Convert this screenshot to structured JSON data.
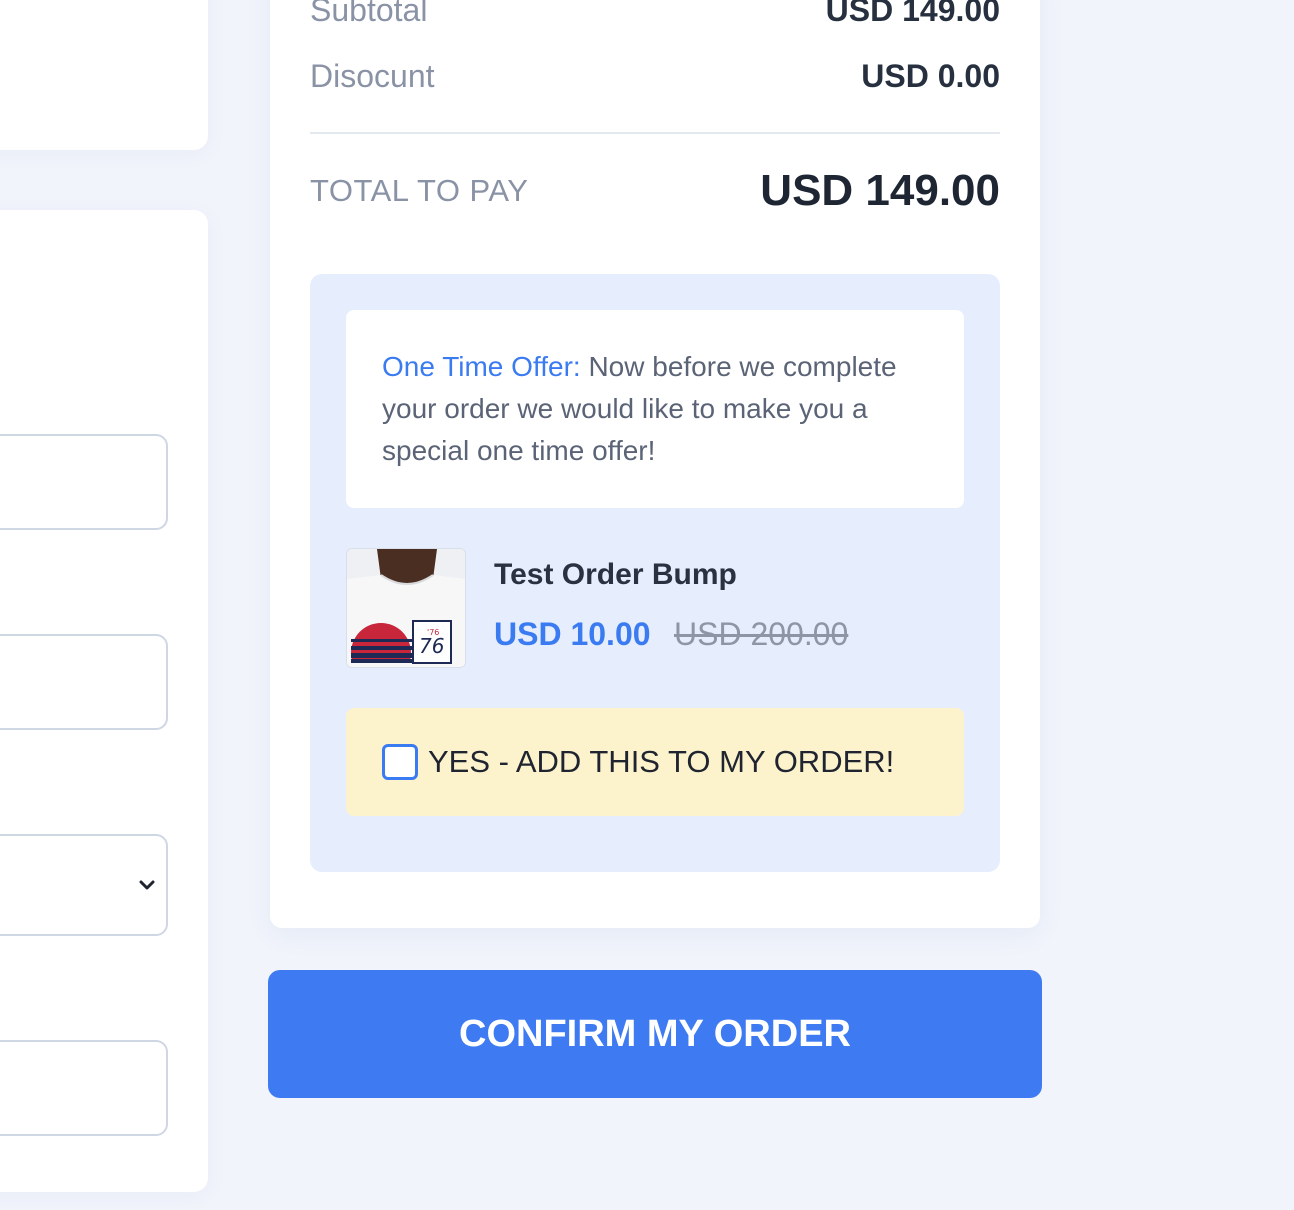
{
  "summary": {
    "subtotal_label": "Subtotal",
    "subtotal_value": "USD 149.00",
    "discount_label": "Disocunt",
    "discount_value": "USD 0.00",
    "total_label": "TOTAL TO PAY",
    "total_value": "USD 149.00"
  },
  "order_bump": {
    "offer_highlight": "One Time Offer:",
    "offer_text": " Now before we complete your order we would like to make you a special one time offer!",
    "product_name": "Test Order Bump",
    "price": "USD 10.00",
    "original_price": "USD 200.00",
    "add_label": "YES - ADD THIS TO MY ORDER!",
    "checked": false
  },
  "confirm_button": {
    "label": "CONFIRM MY ORDER"
  },
  "colors": {
    "accent": "#3e7bf3",
    "bump_background": "#e6eefd",
    "add_box_background": "#fcf3cc",
    "page_background": "#f1f4fb"
  },
  "icons": {
    "select_chevron": "chevron-down-icon",
    "product_image": "tshirt-product-image"
  }
}
